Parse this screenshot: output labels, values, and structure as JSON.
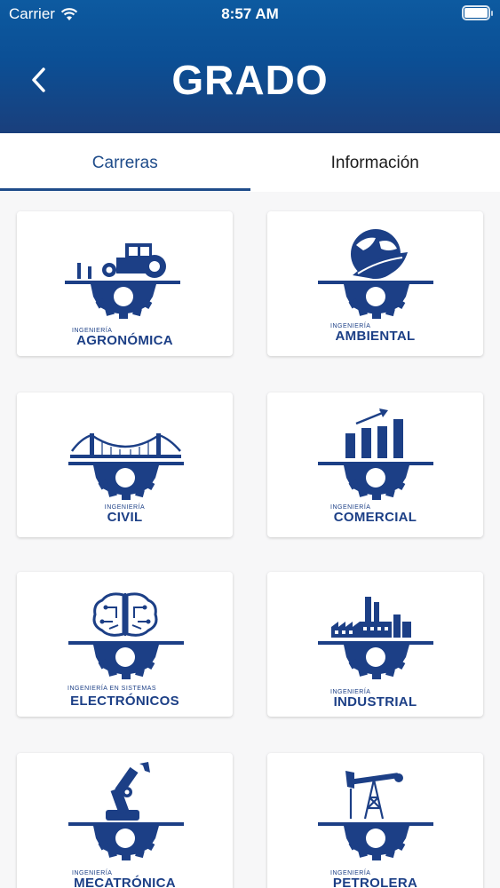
{
  "status_bar": {
    "carrier": "Carrier",
    "time": "8:57 AM"
  },
  "header": {
    "title": "GRADO"
  },
  "tabs": [
    {
      "label": "Carreras",
      "active": true
    },
    {
      "label": "Información",
      "active": false
    }
  ],
  "colors": {
    "brand": "#1c3f86",
    "header_top": "#0d5aa0",
    "header_bottom": "#1a3f7c"
  },
  "careers": [
    {
      "prefix": "INGENIERÍA",
      "name": "AGRONÓMICA",
      "icon": "tractor-gear-icon"
    },
    {
      "prefix": "INGENIERÍA",
      "name": "AMBIENTAL",
      "icon": "globe-leaf-gear-icon"
    },
    {
      "prefix": "INGENIERÍA",
      "name": "CIVIL",
      "icon": "bridge-gear-icon"
    },
    {
      "prefix": "INGENIERÍA",
      "name": "COMERCIAL",
      "icon": "bar-chart-gear-icon"
    },
    {
      "prefix": "INGENIERÍA EN SISTEMAS",
      "name": "ELECTRÓNICOS",
      "icon": "circuit-brain-gear-icon"
    },
    {
      "prefix": "INGENIERÍA",
      "name": "INDUSTRIAL",
      "icon": "factory-gear-icon"
    },
    {
      "prefix": "INGENIERÍA",
      "name": "MECATRÓNICA",
      "icon": "robot-arm-gear-icon"
    },
    {
      "prefix": "INGENIERÍA",
      "name": "PETROLERA",
      "icon": "oil-pump-gear-icon"
    }
  ]
}
